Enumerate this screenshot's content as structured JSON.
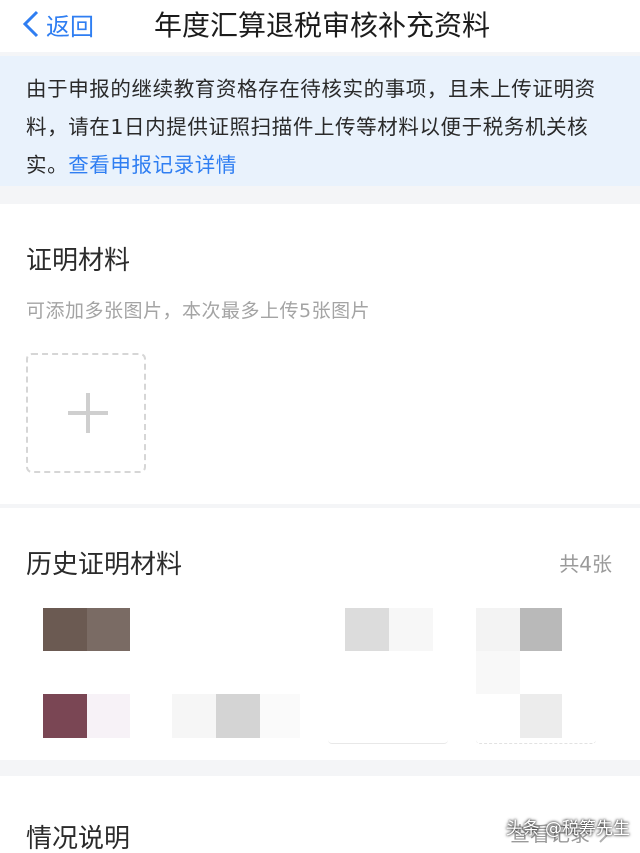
{
  "nav": {
    "back_label": "返回",
    "title": "年度汇算退税审核补充资料"
  },
  "notice": {
    "text": "由于申报的继续教育资格存在待核实的事项，且未上传证明资料，请在1日内提供证照扫描件上传等材料以便于税务机关核实。",
    "link": "查看申报记录详情"
  },
  "proof": {
    "title": "证明材料",
    "hint": "可添加多张图片，本次最多上传5张图片"
  },
  "history": {
    "title": "历史证明材料",
    "count": "共4张"
  },
  "situation": {
    "title": "情况说明",
    "link": "查看记录"
  },
  "watermark": "头条 @税筹先生",
  "colors": {
    "accent": "#2f7ef2",
    "notice_bg": "#e9f2fc"
  }
}
